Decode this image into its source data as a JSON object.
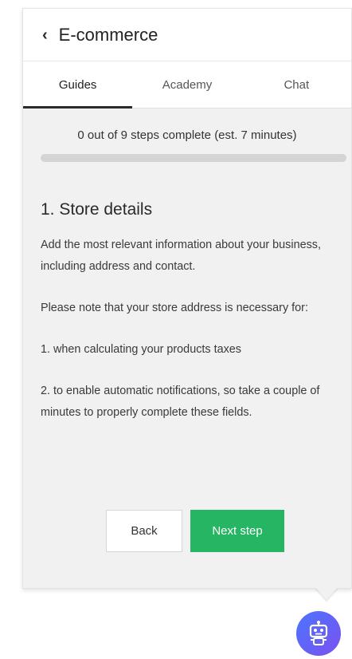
{
  "header": {
    "back_glyph": "‹",
    "title": "E-commerce"
  },
  "tabs": [
    {
      "label": "Guides",
      "active": true
    },
    {
      "label": "Academy",
      "active": false
    },
    {
      "label": "Chat",
      "active": false
    }
  ],
  "progress": {
    "text": "0 out of 9 steps complete (est. 7 minutes)",
    "completed": 0,
    "total": 9
  },
  "step": {
    "title": "1. Store details",
    "paragraphs": [
      "Add the most relevant information about your business, including address and contact.",
      "Please note that your store address is necessary for:",
      "1. when calculating your products taxes",
      "2. to enable automatic notifications, so take a couple of minutes to properly complete these fields."
    ]
  },
  "buttons": {
    "back_label": "Back",
    "next_label": "Next step"
  },
  "colors": {
    "accent_green": "#26b563",
    "bot_gradient_start": "#4c74ff",
    "bot_gradient_end": "#7a52f0"
  },
  "icons": {
    "back": "chevron-left-icon",
    "assistant": "robot-icon"
  }
}
